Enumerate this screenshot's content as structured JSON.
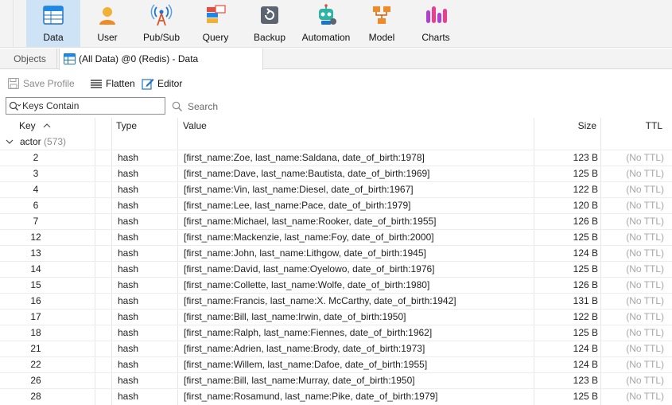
{
  "ribbon": {
    "items": [
      {
        "label": "Data",
        "icon": "data-icon"
      },
      {
        "label": "User",
        "icon": "user-icon"
      },
      {
        "label": "Pub/Sub",
        "icon": "pubsub-icon"
      },
      {
        "label": "Query",
        "icon": "query-icon"
      },
      {
        "label": "Backup",
        "icon": "backup-icon"
      },
      {
        "label": "Automation",
        "icon": "automation-icon"
      },
      {
        "label": "Model",
        "icon": "model-icon"
      },
      {
        "label": "Charts",
        "icon": "charts-icon"
      }
    ],
    "active": "Data",
    "active_color": "#cfe3f7"
  },
  "tabs": {
    "objects": "Objects",
    "data_tab": "(All Data) @0 (Redis) - Data"
  },
  "toolbar": {
    "save_profile": "Save Profile",
    "flatten": "Flatten",
    "editor": "Editor"
  },
  "search": {
    "placeholder": "Keys Contain",
    "button": "Search"
  },
  "grid": {
    "columns": {
      "key": "Key",
      "type": "Type",
      "value": "Value",
      "size": "Size",
      "ttl": "TTL"
    },
    "group": {
      "name": "actor",
      "count": "(573)"
    },
    "rows": [
      {
        "key": "2",
        "type": "hash",
        "value": "[first_name:Zoe, last_name:Saldana, date_of_birth:1978]",
        "size": "123 B",
        "ttl": "(No TTL)"
      },
      {
        "key": "3",
        "type": "hash",
        "value": "[first_name:Dave, last_name:Bautista, date_of_birth:1969]",
        "size": "125 B",
        "ttl": "(No TTL)"
      },
      {
        "key": "4",
        "type": "hash",
        "value": "[first_name:Vin, last_name:Diesel, date_of_birth:1967]",
        "size": "122 B",
        "ttl": "(No TTL)"
      },
      {
        "key": "6",
        "type": "hash",
        "value": "[first_name:Lee, last_name:Pace, date_of_birth:1979]",
        "size": "120 B",
        "ttl": "(No TTL)"
      },
      {
        "key": "7",
        "type": "hash",
        "value": "[first_name:Michael, last_name:Rooker, date_of_birth:1955]",
        "size": "126 B",
        "ttl": "(No TTL)"
      },
      {
        "key": "12",
        "type": "hash",
        "value": "[first_name:Mackenzie, last_name:Foy, date_of_birth:2000]",
        "size": "125 B",
        "ttl": "(No TTL)"
      },
      {
        "key": "13",
        "type": "hash",
        "value": "[first_name:John, last_name:Lithgow, date_of_birth:1945]",
        "size": "124 B",
        "ttl": "(No TTL)"
      },
      {
        "key": "14",
        "type": "hash",
        "value": "[first_name:David, last_name:Oyelowo, date_of_birth:1976]",
        "size": "125 B",
        "ttl": "(No TTL)"
      },
      {
        "key": "15",
        "type": "hash",
        "value": "[first_name:Collette, last_name:Wolfe, date_of_birth:1980]",
        "size": "126 B",
        "ttl": "(No TTL)"
      },
      {
        "key": "16",
        "type": "hash",
        "value": "[first_name:Francis, last_name:X. McCarthy, date_of_birth:1942]",
        "size": "131 B",
        "ttl": "(No TTL)"
      },
      {
        "key": "17",
        "type": "hash",
        "value": "[first_name:Bill, last_name:Irwin, date_of_birth:1950]",
        "size": "122 B",
        "ttl": "(No TTL)"
      },
      {
        "key": "18",
        "type": "hash",
        "value": "[first_name:Ralph, last_name:Fiennes, date_of_birth:1962]",
        "size": "125 B",
        "ttl": "(No TTL)"
      },
      {
        "key": "21",
        "type": "hash",
        "value": "[first_name:Adrien, last_name:Brody, date_of_birth:1973]",
        "size": "124 B",
        "ttl": "(No TTL)"
      },
      {
        "key": "22",
        "type": "hash",
        "value": "[first_name:Willem, last_name:Dafoe, date_of_birth:1955]",
        "size": "124 B",
        "ttl": "(No TTL)"
      },
      {
        "key": "26",
        "type": "hash",
        "value": "[first_name:Bill, last_name:Murray, date_of_birth:1950]",
        "size": "123 B",
        "ttl": "(No TTL)"
      },
      {
        "key": "28",
        "type": "hash",
        "value": "[first_name:Rosamund, last_name:Pike, date_of_birth:1979]",
        "size": "125 B",
        "ttl": "(No TTL)"
      }
    ]
  }
}
